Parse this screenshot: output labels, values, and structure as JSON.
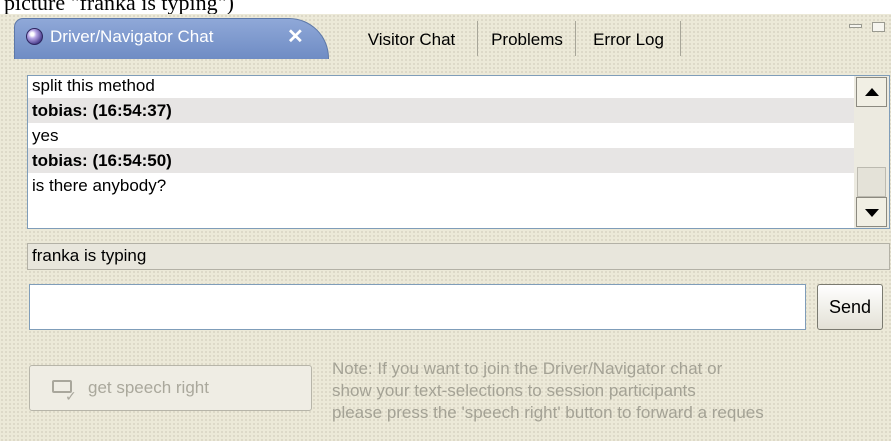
{
  "caption": "picture \"franka is typing\")",
  "tabs": {
    "active": {
      "label": "Driver/Navigator Chat",
      "close_glyph": "✕"
    },
    "others": [
      {
        "label": "Visitor Chat"
      },
      {
        "label": "Problems"
      },
      {
        "label": "Error Log"
      }
    ]
  },
  "chat": {
    "lines": [
      {
        "text": "split this method",
        "type": "message"
      },
      {
        "text": "tobias: (16:54:37)",
        "type": "header"
      },
      {
        "text": "yes",
        "type": "message"
      },
      {
        "text": "tobias: (16:54:50)",
        "type": "header"
      },
      {
        "text": "is there anybody?",
        "type": "message"
      }
    ]
  },
  "status": {
    "typing_text": "franka is typing"
  },
  "input": {
    "value": "",
    "placeholder": ""
  },
  "send_label": "Send",
  "speech_button_label": "get speech right",
  "note_lines": [
    "Note: If you want to join the Driver/Navigator chat or",
    "show your text-selections to session participants",
    "please press the 'speech right' button to forward a reques"
  ],
  "colors": {
    "active_tab": "#7f9ace",
    "panel_bg": "#ece9d8",
    "disabled_text": "#a4a295"
  },
  "icons": {
    "tab": "collaboration-globe-icon",
    "speech": "speech-bubble-check-icon"
  }
}
